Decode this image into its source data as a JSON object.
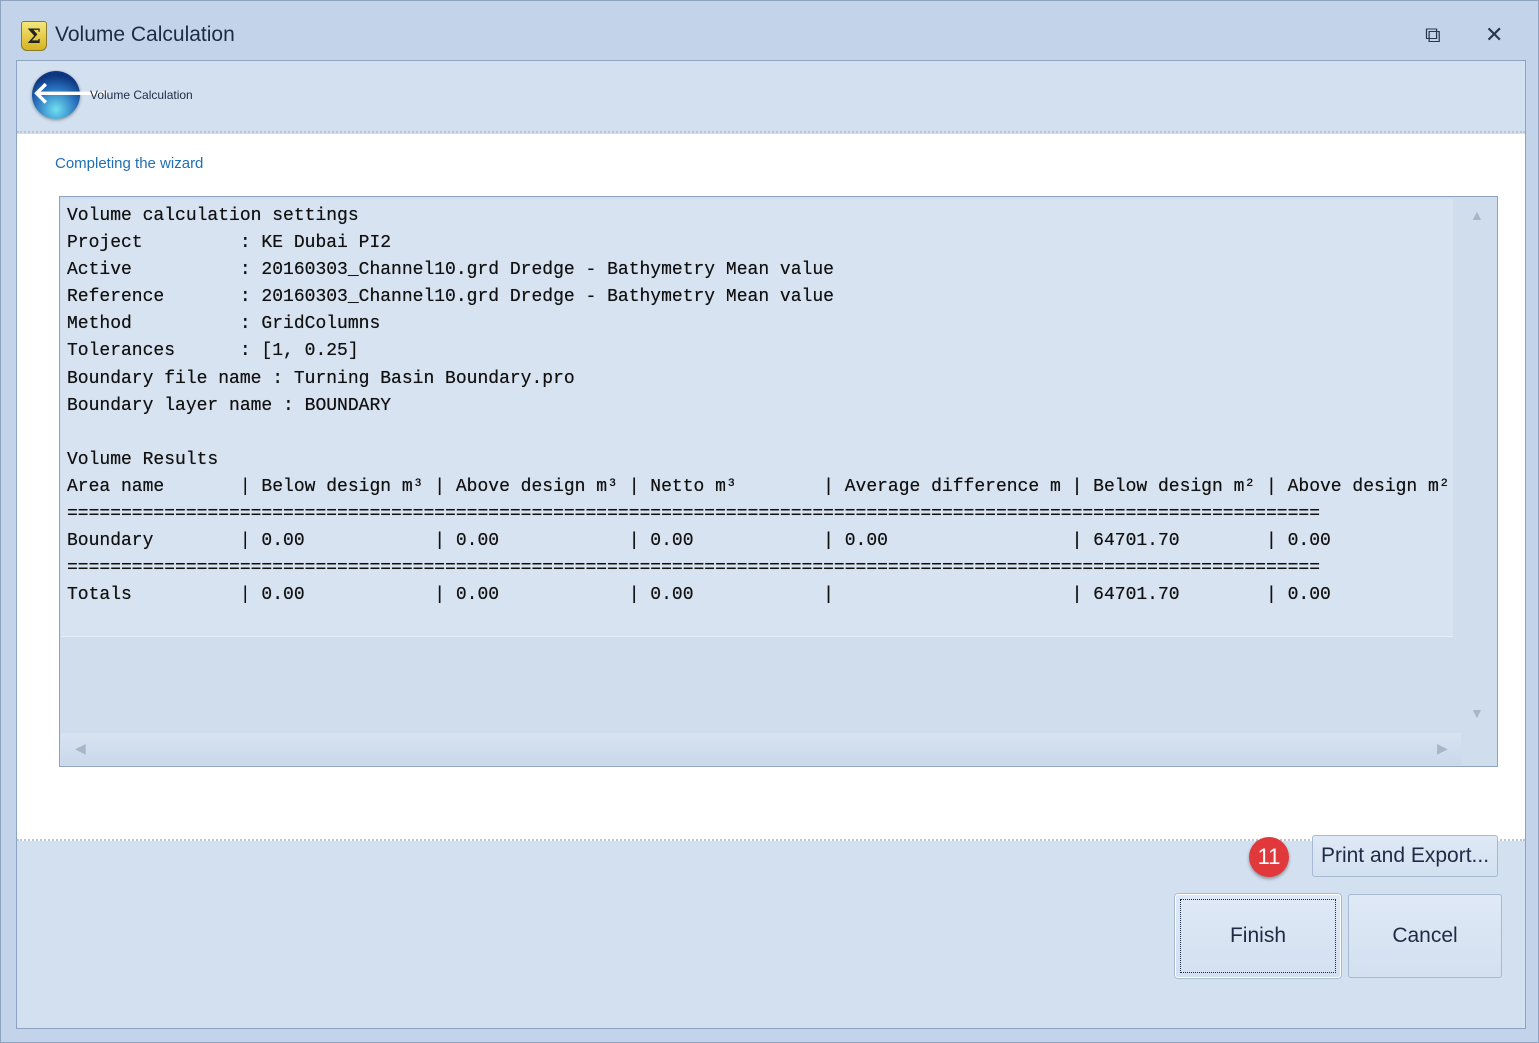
{
  "window": {
    "title": "Volume Calculation",
    "app_icon": "sigma-icon",
    "restore_icon": "restore-icon",
    "close_icon": "close-icon"
  },
  "header": {
    "title": "Volume Calculation",
    "back_icon": "back-arrow-icon"
  },
  "body": {
    "subtitle": "Completing the wizard"
  },
  "report": {
    "lines": [
      "Volume calculation settings",
      "Project         : KE Dubai PI2",
      "Active          : 20160303_Channel10.grd Dredge - Bathymetry Mean value",
      "Reference       : 20160303_Channel10.grd Dredge - Bathymetry Mean value",
      "Method          : GridColumns",
      "Tolerances      : [1, 0.25]",
      "Boundary file name : Turning Basin Boundary.pro",
      "Boundary layer name : BOUNDARY",
      "",
      "Volume Results",
      "Area name       | Below design m³ | Above design m³ | Netto m³        | Average difference m | Below design m² | Above design m²",
      "====================================================================================================================",
      "Boundary        | 0.00            | 0.00            | 0.00            | 0.00                 | 64701.70        | 0.00",
      "====================================================================================================================",
      "Totals          | 0.00            | 0.00            | 0.00            |                      | 64701.70        | 0.00"
    ]
  },
  "annotation": {
    "step_badge": "11"
  },
  "buttons": {
    "print_export": "Print and Export...",
    "finish": "Finish",
    "cancel": "Cancel"
  }
}
